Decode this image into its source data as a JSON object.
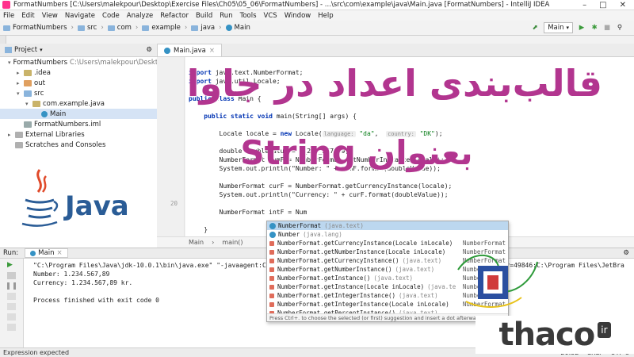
{
  "window": {
    "title": "FormatNumbers [C:\\Users\\malekpour\\Desktop\\Exercise Files\\Ch05\\05_06\\FormatNumbers] - ...\\src\\com\\example\\java\\Main.java [FormatNumbers] - IntelliJ IDEA",
    "controls": [
      "–",
      "□",
      "✕"
    ]
  },
  "menu": [
    "File",
    "Edit",
    "View",
    "Navigate",
    "Code",
    "Analyze",
    "Refactor",
    "Build",
    "Run",
    "Tools",
    "VCS",
    "Window",
    "Help"
  ],
  "breadcrumbs": [
    "FormatNumbers",
    "src",
    "com",
    "example",
    "java",
    "Main"
  ],
  "run_config": "Main",
  "project": {
    "header": "Project",
    "tree": [
      {
        "label": "FormatNumbers",
        "path": "C:\\Users\\malekpour\\Desktop\\Exe",
        "level": 0,
        "arrow": "▾",
        "icon_color": "#8ab4dc"
      },
      {
        "label": ".idea",
        "path": "",
        "level": 1,
        "arrow": "▸",
        "icon_color": "#c9b36a"
      },
      {
        "label": "out",
        "path": "",
        "level": 1,
        "arrow": "▸",
        "icon_color": "#e0a060"
      },
      {
        "label": "src",
        "path": "",
        "level": 1,
        "arrow": "▾",
        "icon_color": "#8ab4dc"
      },
      {
        "label": "com.example.java",
        "path": "",
        "level": 2,
        "arrow": "▾",
        "icon_color": "#c9b36a"
      },
      {
        "label": "Main",
        "path": "",
        "level": 3,
        "arrow": "",
        "icon_color": "#3592c4"
      },
      {
        "label": "FormatNumbers.iml",
        "path": "",
        "level": 1,
        "arrow": "",
        "icon_color": "#9aa"
      },
      {
        "label": "External Libraries",
        "path": "",
        "level": 0,
        "arrow": "▸",
        "icon_color": "#b0b0b0"
      },
      {
        "label": "Scratches and Consoles",
        "path": "",
        "level": 0,
        "arrow": "",
        "icon_color": "#b0b0b0"
      }
    ]
  },
  "editor": {
    "tab": "Main.java",
    "line_numbers": [
      "",
      "",
      "",
      "",
      "",
      "",
      "",
      "",
      "",
      "",
      "",
      "",
      "",
      "",
      "",
      "",
      "20",
      "",
      "",
      ""
    ],
    "code_lines": [
      {
        "segments": [
          {
            "t": "",
            "c": ""
          }
        ]
      },
      {
        "segments": [
          {
            "t": "import ",
            "c": "kw"
          },
          {
            "t": "java.text.NumberFormat;",
            "c": ""
          }
        ]
      },
      {
        "segments": [
          {
            "t": "import ",
            "c": "kw"
          },
          {
            "t": "java.util.Locale;",
            "c": ""
          }
        ]
      },
      {
        "segments": [
          {
            "t": "",
            "c": ""
          }
        ]
      },
      {
        "segments": [
          {
            "t": "public class ",
            "c": "kw"
          },
          {
            "t": "Main {",
            "c": ""
          }
        ]
      },
      {
        "segments": [
          {
            "t": "",
            "c": ""
          }
        ]
      },
      {
        "segments": [
          {
            "t": "    public static void ",
            "c": "kw"
          },
          {
            "t": "main(String[] args) {",
            "c": ""
          }
        ]
      },
      {
        "segments": [
          {
            "t": "",
            "c": ""
          }
        ]
      },
      {
        "segments": [
          {
            "t": "        Locale locale = ",
            "c": ""
          },
          {
            "t": "new ",
            "c": "kw"
          },
          {
            "t": "Locale(",
            "c": ""
          },
          {
            "t": "language:",
            "c": "hint"
          },
          {
            "t": " ",
            "c": ""
          },
          {
            "t": "\"da\"",
            "c": "str"
          },
          {
            "t": ",  ",
            "c": ""
          },
          {
            "t": "country:",
            "c": "hint"
          },
          {
            "t": " ",
            "c": ""
          },
          {
            "t": "\"DK\"",
            "c": "str"
          },
          {
            "t": ");",
            "c": ""
          }
        ]
      },
      {
        "segments": [
          {
            "t": "",
            "c": ""
          }
        ]
      },
      {
        "segments": [
          {
            "t": "        double doubleValue = 1_234_567.89;",
            "c": ""
          }
        ]
      },
      {
        "segments": [
          {
            "t": "        NumberFormat numF = NumberFormat.getNumberInstance(locale);",
            "c": ""
          }
        ]
      },
      {
        "segments": [
          {
            "t": "        System.out.println(\"Number: \" + numF.format(doubleValue));",
            "c": ""
          }
        ]
      },
      {
        "segments": [
          {
            "t": "",
            "c": ""
          }
        ]
      },
      {
        "segments": [
          {
            "t": "        NumberFormat curF = NumberFormat.getCurrencyInstance(locale);",
            "c": ""
          }
        ]
      },
      {
        "segments": [
          {
            "t": "        System.out.println(\"Currency: \" + curF.format(doubleValue));",
            "c": ""
          }
        ]
      },
      {
        "segments": [
          {
            "t": "",
            "c": ""
          }
        ]
      },
      {
        "segments": [
          {
            "t": "        NumberFormat intF = Num",
            "c": ""
          }
        ]
      },
      {
        "segments": [
          {
            "t": "",
            "c": ""
          }
        ]
      },
      {
        "segments": [
          {
            "t": "    }",
            "c": ""
          }
        ]
      }
    ],
    "breadcrumb_bottom": [
      "Main",
      "main()"
    ]
  },
  "completion": {
    "items": [
      {
        "name": "NumberFormat",
        "pkg": "(java.text)",
        "ret": "",
        "type": "class"
      },
      {
        "name": "Number",
        "pkg": "(java.lang)",
        "ret": "",
        "type": "class"
      },
      {
        "name": "NumberFormat.getCurrencyInstance(Locale inLocale)",
        "pkg": "",
        "ret": "NumberFormat",
        "type": "method"
      },
      {
        "name": "NumberFormat.getNumberInstance(Locale inLocale)",
        "pkg": "",
        "ret": "NumberFormat",
        "type": "method"
      },
      {
        "name": "NumberFormat.getCurrencyInstance()",
        "pkg": "(java.text)",
        "ret": "NumberFormat",
        "type": "method"
      },
      {
        "name": "NumberFormat.getNumberInstance()",
        "pkg": "(java.text)",
        "ret": "NumberFormat",
        "type": "method"
      },
      {
        "name": "NumberFormat.getInstance()",
        "pkg": "(java.text)",
        "ret": "NumberFormat",
        "type": "method"
      },
      {
        "name": "NumberFormat.getInstance(Locale inLocale)",
        "pkg": "(java.te",
        "ret": "NumberFormat",
        "type": "method"
      },
      {
        "name": "NumberFormat.getIntegerInstance()",
        "pkg": "(java.text)",
        "ret": "NumberFormat",
        "type": "method"
      },
      {
        "name": "NumberFormat.getIntegerInstance(Locale inLocale)",
        "pkg": "",
        "ret": "NumberFormat",
        "type": "method"
      },
      {
        "name": "NumberFormat.getPercentInstance()",
        "pkg": "(java.text)",
        "ret": "",
        "type": "method"
      }
    ],
    "footer": "Press Ctrl+. to choose the selected (or first) suggestion and insert a dot afterwards  >>"
  },
  "run": {
    "label": "Run:",
    "config": "Main",
    "lines": [
      "\"C:\\Program Files\\Java\\jdk-10.0.1\\bin\\java.exe\" \"-javaagent:C:\\Prog",
      "Number: 1.234.567,89",
      "Currency: 1.234.567,89 kr.",
      "",
      "Process finished with exit code 0"
    ],
    "overflow_text": ".jar=49846:C:\\Program Files\\JetBra"
  },
  "status": {
    "left": "Expression expected",
    "right": [
      "20:32",
      "CRLF",
      "UTF-8"
    ]
  },
  "overlay": {
    "title_line1": "قالب‌بندی اعداد در جاوا",
    "title_line2": "بعنوان String",
    "java_text": "Java",
    "brand": "thaco",
    "brand_suffix": "ir",
    "colors": {
      "accent": "#b2358f",
      "java_blue": "#2a5c96",
      "java_red": "#e04a2a"
    }
  }
}
